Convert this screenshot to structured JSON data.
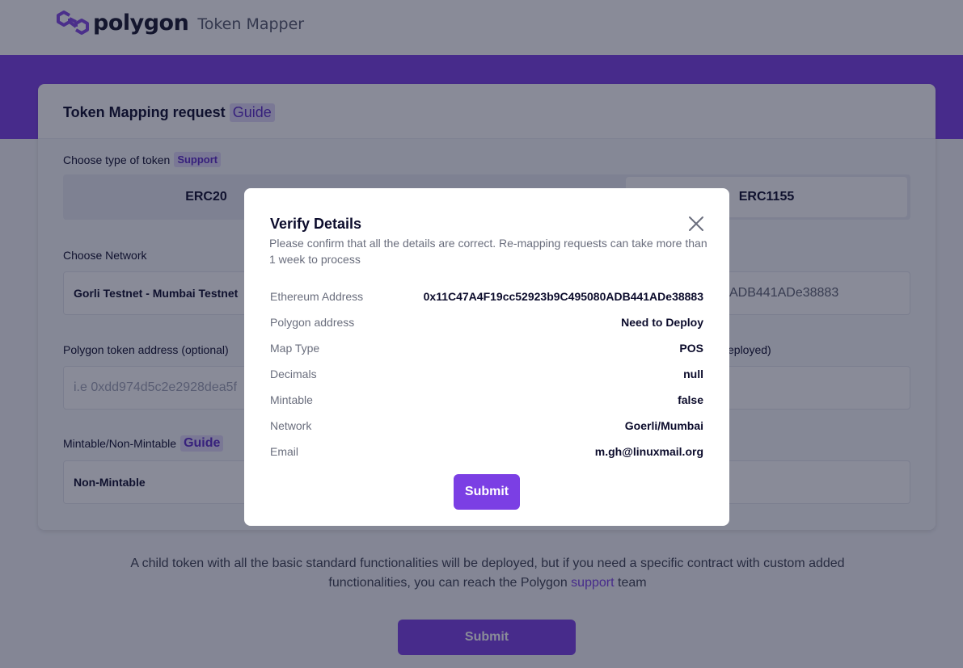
{
  "header": {
    "brand": "polygon",
    "product": "Token Mapper"
  },
  "card": {
    "title": "Token Mapping request",
    "title_tag": "Guide",
    "token_type_label": "Choose type of token",
    "token_type_tag": "Support",
    "token_types": [
      "ERC20",
      "ERC1155"
    ],
    "network_label": "Choose Network",
    "network_value": "Gorli Testnet - Mumbai Testnet",
    "eth_address_partial": "ADB441ADe38883",
    "polygon_address_label": "Polygon token address (optional)",
    "polygon_address_placeholder": "i.e 0xdd974d5c2e2928dea5f",
    "right_label_partial": "eployed)",
    "mintable_label": "Mintable/Non-Mintable",
    "mintable_tag": "Guide",
    "mintable_value": "Non-Mintable"
  },
  "info": {
    "text_before": "A child token with all the basic standard functionalities will be deployed, but if you need a specific contract with custom added functionalities, you can reach the Polygon",
    "link": "support",
    "text_after": "team"
  },
  "main_submit": "Submit",
  "modal": {
    "title": "Verify Details",
    "description": "Please confirm that all the details are correct. Re-mapping requests can take more than 1 week to process",
    "rows": [
      {
        "label": "Ethereum Address",
        "value": "0x11C47A4F19cc52923b9C495080ADB441ADe38883"
      },
      {
        "label": "Polygon address",
        "value": "Need to Deploy"
      },
      {
        "label": "Map Type",
        "value": "POS"
      },
      {
        "label": "Decimals",
        "value": "null"
      },
      {
        "label": "Mintable",
        "value": "false"
      },
      {
        "label": "Network",
        "value": "Goerli/Mumbai"
      },
      {
        "label": "Email",
        "value": "m.gh@linuxmail.org"
      }
    ],
    "submit": "Submit"
  },
  "colors": {
    "accent": "#7b3fe4",
    "tag_bg": "#e1d8f9",
    "overlay": "rgba(20,24,50,0.5)"
  },
  "icons": {
    "logo": "polygon-logo-icon",
    "close": "close-icon"
  }
}
